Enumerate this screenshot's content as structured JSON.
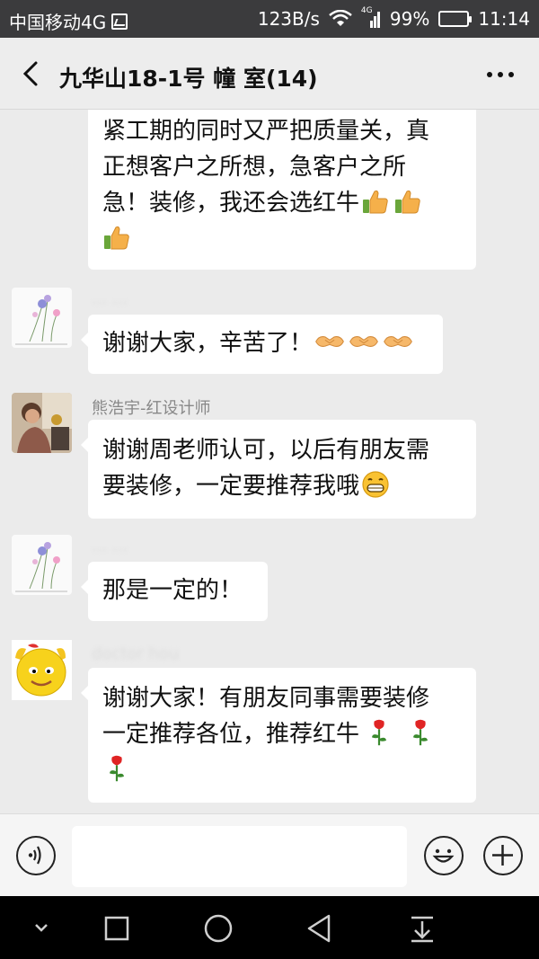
{
  "status_bar": {
    "carrier": "中国移动4G",
    "speed": "123B/s",
    "network": "4G",
    "battery": "99%",
    "battery_level": 0.99,
    "time": "11:14"
  },
  "header": {
    "title": "九华山18-1号 幢   室(14)"
  },
  "messages": [
    {
      "sender": "",
      "lines": [
        "紧工期的同时又严把质量关，真",
        "正想客户之所想，急客户之所",
        "急！装修，我还会选红牛"
      ],
      "emojis": [
        "thumbs-up",
        "thumbs-up",
        "thumbs-up"
      ]
    },
    {
      "sender": "...  ...",
      "lines": [
        "谢谢大家，辛苦了！"
      ],
      "emojis": [
        "handshake",
        "handshake",
        "handshake"
      ]
    },
    {
      "sender": "熊浩宇-红设计师",
      "lines": [
        "谢谢周老师认可，以后有朋友需",
        "要装修，一定要推荐我哦"
      ],
      "emojis": [
        "grin"
      ]
    },
    {
      "sender": "...  ...",
      "lines": [
        "那是一定的！"
      ],
      "emojis": []
    },
    {
      "sender": "doctor hou",
      "lines": [
        "谢谢大家！有朋友同事需要装修",
        "一定推荐各位，推荐红牛"
      ],
      "emojis": [
        "rose",
        "rose",
        "rose"
      ]
    }
  ],
  "input": {
    "placeholder": ""
  },
  "colors": {
    "status_bar": "#3b3b3d",
    "background": "#ebebeb",
    "bubble": "#ffffff",
    "nav_bar": "#000000"
  }
}
